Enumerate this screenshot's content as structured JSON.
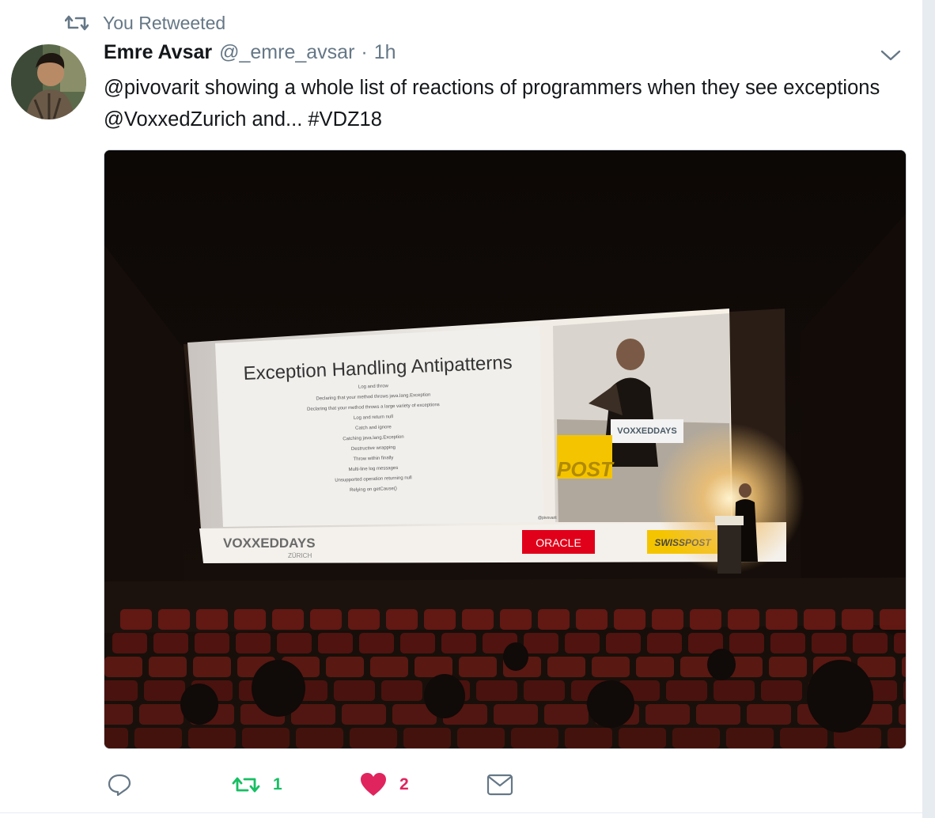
{
  "context": {
    "label": "You Retweeted"
  },
  "author": {
    "name": "Emre Avsar",
    "handle": "@_emre_avsar",
    "separator": "·",
    "time": "1h"
  },
  "tweet": {
    "mention_1": "@pivovarit",
    "text_1": " showing a whole list of reactions of programmers when they see exceptions ",
    "mention_2": "@VoxxedZurich",
    "text_2": " and... ",
    "hashtag": "#VDZ18"
  },
  "slide": {
    "title": "Exception Handling Antipatterns",
    "items": [
      "Log and throw",
      "Declaring that your method throws java.lang.Exception",
      "Declaring that your method throws a large variety of exceptions",
      "Log and return null",
      "Catch and ignore",
      "Catching java.lang.Exception",
      "Destructive wrapping",
      "Throw within finally",
      "Multi-line log messages",
      "Unsupported operation returning null",
      "Relying on getCause()"
    ],
    "footer_handle": "@pivovarit"
  },
  "sponsors": {
    "voxxed_top": "VOXXEDDAYS",
    "voxxed_sub": "ZÜRICH",
    "oracle": "ORACLE",
    "swisspost": "SWISSPOST",
    "post_sign": "POST"
  },
  "actions": {
    "retweet_count": "1",
    "like_count": "2"
  },
  "colors": {
    "retweet": "#17bf63",
    "like": "#e0245e",
    "secondary": "#657786",
    "text": "#14171a",
    "oracle_red": "#e0001a",
    "post_yellow": "#f5c400"
  },
  "icons": {
    "context": "retweet-icon",
    "menu": "chevron-down-icon",
    "reply": "reply-icon",
    "retweet": "retweet-icon",
    "like": "heart-icon",
    "dm": "envelope-icon"
  }
}
